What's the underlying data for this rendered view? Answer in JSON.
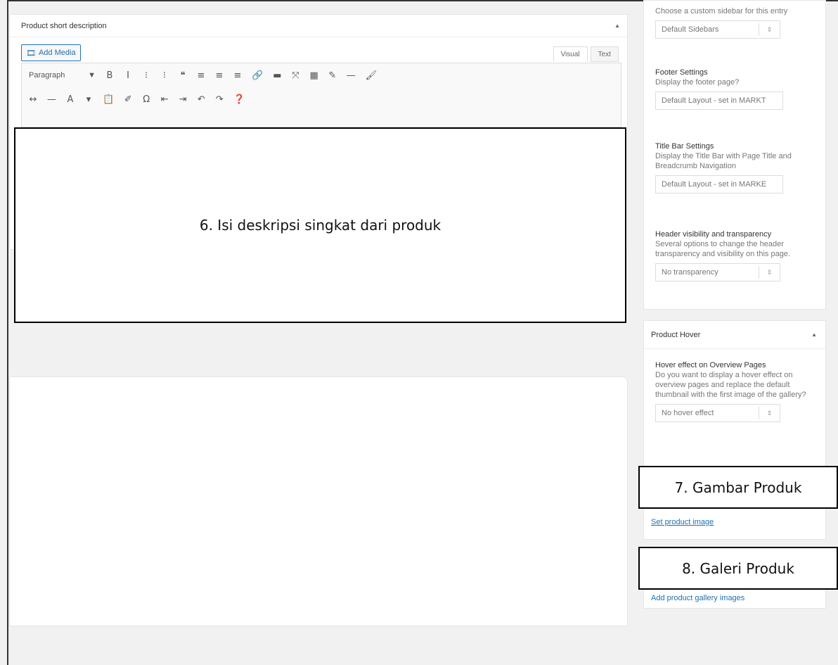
{
  "editor": {
    "title": "Product short description",
    "add_media": "Add Media",
    "tab_visual": "Visual",
    "tab_text": "Text",
    "format_select": "Paragraph",
    "format_arrow": "▼",
    "toolbar_row1": [
      "B",
      "I",
      "⁝",
      "⁝",
      "❝",
      "≡",
      "≡",
      "≡",
      "🔗",
      "▬",
      "⤧",
      "▦",
      "✎",
      "—",
      "🖌"
    ],
    "toolbar_row2": [
      "↔",
      "—",
      "A",
      "▾",
      "📋",
      "✐",
      "Ω",
      "⇤",
      "⇥",
      "↶",
      "↷",
      "❓"
    ]
  },
  "annotations": {
    "a6": "6. Isi deskripsi singkat dari produk",
    "a7": "7. Gambar Produk",
    "a8": "8. Galeri Produk"
  },
  "sidebar": {
    "sidebar_desc": "Choose a custom sidebar for this entry",
    "sidebar_select": "Default Sidebars",
    "footer_title": "Footer Settings",
    "footer_desc": "Display the footer page?",
    "footer_select": "Default Layout - set in MARKT",
    "titlebar_title": "Title Bar Settings",
    "titlebar_desc": "Display the Title Bar with Page Title and Breadcrumb Navigation",
    "titlebar_select": "Default Layout - set in MARKE",
    "header_title": "Header visibility and transparency",
    "header_desc": "Several options to change the header transparency and visibility on this page.",
    "header_select": "No transparency",
    "select_arrow": "⇕"
  },
  "product_hover": {
    "title": "Product Hover",
    "toggle": "▲",
    "effect_title": "Hover effect on Overview Pages",
    "effect_desc": "Do you want to display a hover effect on overview pages and replace the default thumbnail with the first image of the gallery?",
    "select": "No hover effect"
  },
  "product_image": {
    "link": "Set product image"
  },
  "gallery": {
    "link": "Add product gallery images"
  },
  "colors": {
    "link": "#2271b1",
    "border": "#000000"
  }
}
